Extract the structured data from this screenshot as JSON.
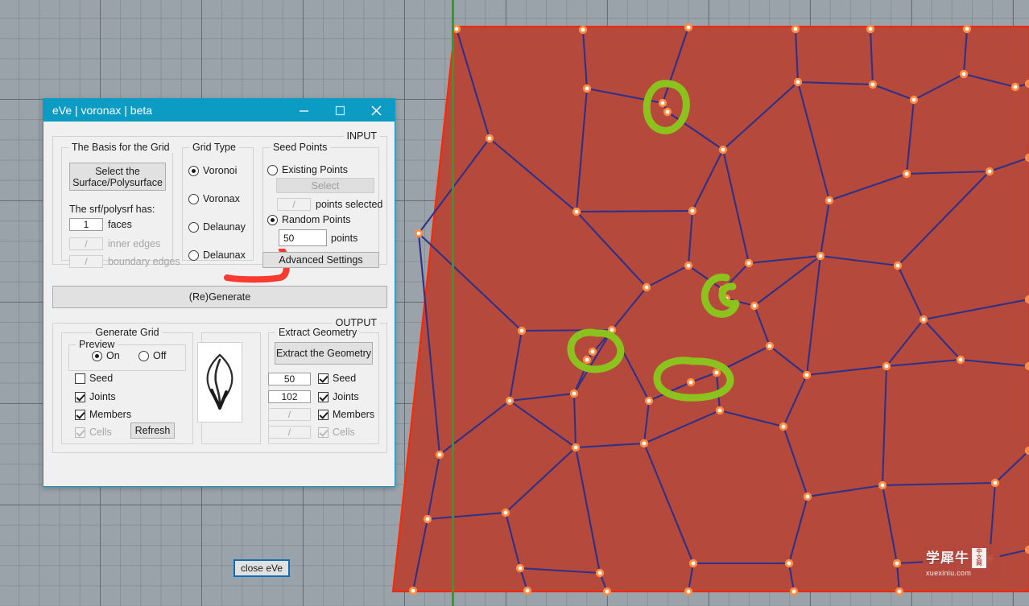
{
  "app": {
    "title": "eVe | voronax | beta",
    "window_buttons": [
      {
        "name": "minimize-button",
        "glyph": "—"
      },
      {
        "name": "maximize-button",
        "glyph": "▢"
      },
      {
        "name": "close-button",
        "glyph": "✕"
      }
    ]
  },
  "input_section": {
    "label": "INPUT",
    "basis_group": {
      "label": "The Basis for the Grid",
      "select_button": "Select the\nSurface/Polysurface",
      "select_button_line1": "Select the",
      "select_button_line2": "Surface/Polysurface",
      "has_label": "The srf/polysrf has:",
      "fields": [
        {
          "value": "1",
          "label": "faces",
          "disabled": false
        },
        {
          "value": "/",
          "label": "inner edges",
          "disabled": true
        },
        {
          "value": "/",
          "label": "boundary edges",
          "disabled": true
        }
      ]
    },
    "grid_type_group": {
      "label": "Grid Type",
      "options": [
        {
          "label": "Voronoi",
          "selected": true
        },
        {
          "label": "Voronax",
          "selected": false
        },
        {
          "label": "Delaunay",
          "selected": false
        },
        {
          "label": "Delaunax",
          "selected": false
        }
      ]
    },
    "seed_points_group": {
      "label": "Seed Points",
      "existing_points_label": "Existing Points",
      "existing_points_selected": false,
      "select_button": "Select",
      "points_selected_value": "/",
      "points_selected_label": "points selected",
      "random_points_label": "Random Points",
      "random_points_selected": true,
      "random_points_value": "50",
      "points_label": "points",
      "advanced_settings": "Advanced Settings"
    }
  },
  "regenerate_button": "(Re)Generate",
  "output_section": {
    "label": "OUTPUT",
    "generate_grid_group": {
      "label": "Generate Grid",
      "preview_group": {
        "label": "Preview",
        "on_label": "On",
        "off_label": "Off",
        "selected": "On"
      },
      "checkboxes": [
        {
          "label": "Seed",
          "checked": false,
          "disabled": false
        },
        {
          "label": "Joints",
          "checked": true,
          "disabled": false
        },
        {
          "label": "Members",
          "checked": true,
          "disabled": false
        },
        {
          "label": "Cells",
          "checked": true,
          "disabled": true
        }
      ],
      "refresh_button": "Refresh"
    },
    "logo": {
      "name": "eve-leaf-logo"
    },
    "extract_geometry_group": {
      "label": "Extract Geometry",
      "extract_button": "Extract the Geometry",
      "rows": [
        {
          "count": "50",
          "label": "Seed",
          "checked": true,
          "disabled": false
        },
        {
          "count": "102",
          "label": "Joints",
          "checked": true,
          "disabled": false
        },
        {
          "count": "/",
          "label": "Members",
          "checked": true,
          "disabled": true
        },
        {
          "count": "/",
          "label": "Cells",
          "checked": true,
          "disabled": true
        }
      ]
    }
  },
  "close_button": "close eVe",
  "viewport": {
    "name": "rhino-perspective-viewport",
    "background_color": "#9aa2aa",
    "grid_line_color": "#78808a",
    "surface_fill_color": "#b5493c",
    "surface_edge_color": "#ff2600",
    "mesh_line_color": "#2e3188",
    "point_color": "#ff8c42",
    "point_core_color": "#ffffff",
    "axis_green_color": "#2e9e28",
    "annotation_color": "#8cc21e",
    "annotation_red_color": "#f93a31",
    "annotations": [
      {
        "name": "highlight-circle-top",
        "note": "two coincident joints"
      },
      {
        "name": "highlight-circle-middle",
        "note": "two coincident joints"
      },
      {
        "name": "highlight-circle-left",
        "note": "two coincident joints"
      },
      {
        "name": "highlight-circle-bottom",
        "note": "cluster of short members"
      }
    ]
  },
  "watermark": {
    "chinese": "学犀牛",
    "badge_line1": "中",
    "badge_line2": "文",
    "badge_line3": "网",
    "url": "xuexiniu.com"
  }
}
